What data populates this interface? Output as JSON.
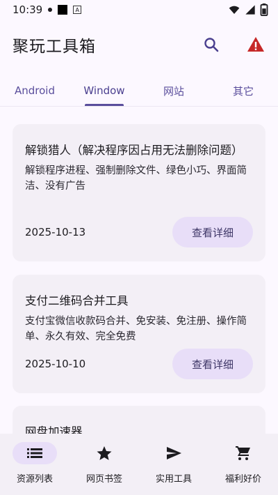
{
  "status_bar": {
    "time": "10:39",
    "app_icon_letter": "A"
  },
  "app_bar": {
    "title": "聚玩工具箱",
    "warning_color": "#c62828",
    "search_color": "#4a3f8f"
  },
  "tabs": [
    {
      "label": "Android",
      "active": false
    },
    {
      "label": "Window",
      "active": true
    },
    {
      "label": "网站",
      "active": false
    },
    {
      "label": "其它",
      "active": false
    }
  ],
  "cards": [
    {
      "title": "解锁猎人（解决程序因占用无法删除问题）",
      "description": "解锁程序进程、强制删除文件、绿色小巧、界面简洁、没有广告",
      "date": "2025-10-13",
      "button": "查看详细"
    },
    {
      "title": "支付二维码合并工具",
      "description": "支付宝微信收款码合并、免安装、免注册、操作简单、永久有效、完全免费",
      "date": "2025-10-10",
      "button": "查看详细"
    },
    {
      "title": "网盘加速器"
    }
  ],
  "bottom_nav": [
    {
      "label": "资源列表",
      "icon": "list-icon",
      "active": true
    },
    {
      "label": "网页书签",
      "icon": "star-icon",
      "active": false
    },
    {
      "label": "实用工具",
      "icon": "send-icon",
      "active": false
    },
    {
      "label": "福利好价",
      "icon": "cart-icon",
      "active": false
    }
  ]
}
